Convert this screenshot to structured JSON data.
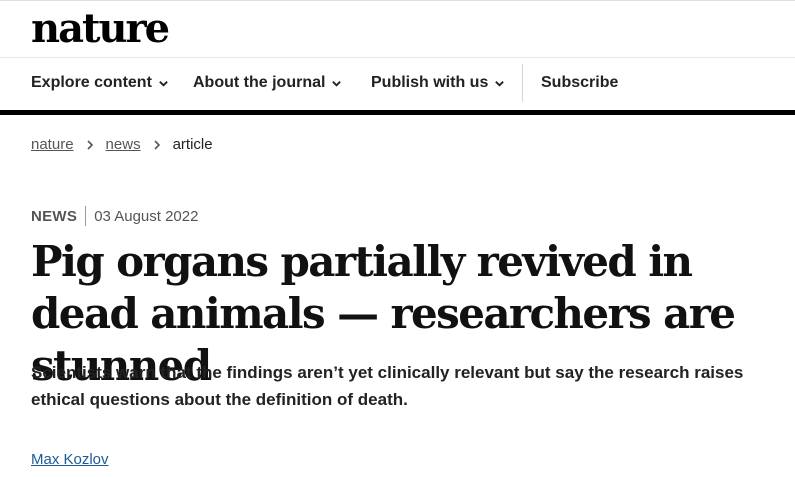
{
  "header": {
    "logo": "nature"
  },
  "nav": {
    "items": [
      {
        "label": "Explore content",
        "has_dropdown": true
      },
      {
        "label": "About the journal",
        "has_dropdown": true
      },
      {
        "label": "Publish with us",
        "has_dropdown": true
      },
      {
        "label": "Subscribe",
        "has_dropdown": false
      }
    ]
  },
  "breadcrumb": {
    "items": [
      "nature",
      "news",
      "article"
    ]
  },
  "article": {
    "type": "NEWS",
    "date": "03 August 2022",
    "title": "Pig organs partially revived in dead animals — researchers are stunned",
    "standfirst": "Scientists warn that the findings aren’t yet clinically relevant but say the research raises ethical questions about the definition of death.",
    "author": "Max Kozlov"
  },
  "colors": {
    "text": "#222222",
    "link": "#1a5c96",
    "nav_border": "#000000"
  }
}
